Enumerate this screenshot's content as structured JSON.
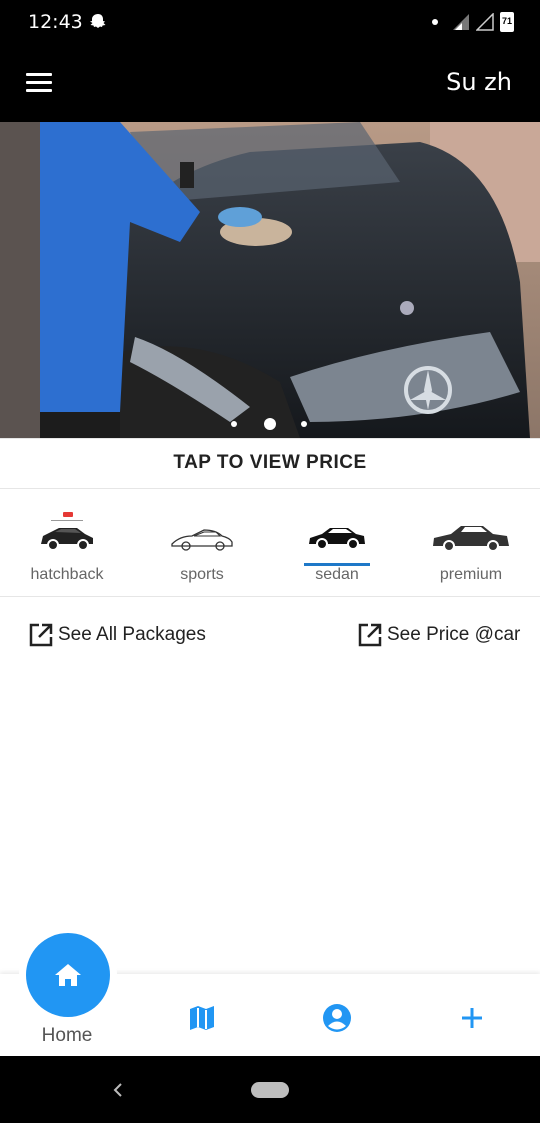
{
  "status_bar": {
    "time": "12:43",
    "battery": "71"
  },
  "app_bar": {
    "user_name": "Su zh"
  },
  "carousel": {
    "page_count": 3,
    "active_index": 1
  },
  "pricing": {
    "title": "TAP TO VIEW PRICE",
    "categories": [
      {
        "label": "hatchback"
      },
      {
        "label": "sports"
      },
      {
        "label": "sedan"
      },
      {
        "label": "premium"
      }
    ],
    "selected": "sedan"
  },
  "links": {
    "packages": "See All Packages",
    "price_at_car": "See Price @car"
  },
  "bottom_nav": {
    "home_label": "Home"
  },
  "colors": {
    "accent": "#2196f3",
    "selected_underline": "#1e78c8",
    "bar_bg": "#000000"
  }
}
